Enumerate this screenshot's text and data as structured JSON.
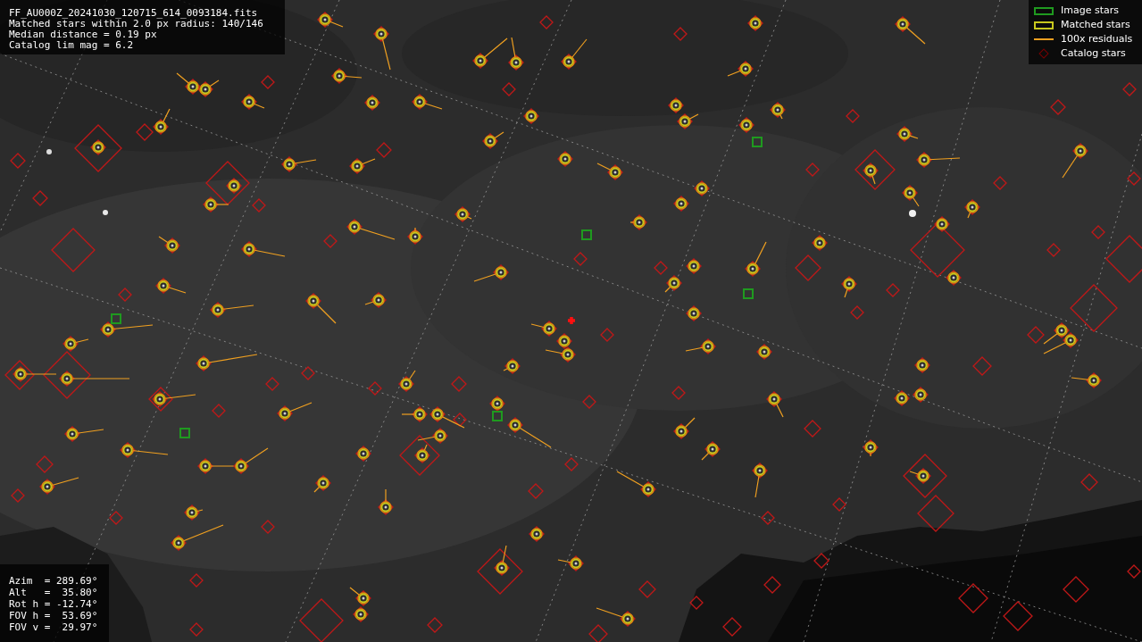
{
  "info_box": {
    "lines": [
      "FF_AU000Z_20241030_120715_614_0093184.fits",
      "Matched stars within 2.0 px radius: 140/146",
      "Median distance = 0.19 px",
      "Catalog lim mag = 6.2"
    ]
  },
  "legend": [
    {
      "label": "Image stars",
      "kind": "box",
      "color": "#1f9a1f"
    },
    {
      "label": "Matched stars",
      "kind": "box",
      "color": "#c8c81e"
    },
    {
      "label": "100x residuals",
      "kind": "line",
      "color": "#f0a020"
    },
    {
      "label": "Catalog stars",
      "kind": "diamond",
      "color": "#7a0000"
    }
  ],
  "pointing": {
    "lines": [
      "Azim  = 289.69°",
      "Alt   =  35.80°",
      "Rot h = -12.74°",
      "FOV h =  53.69°",
      "FOV v =  29.97°"
    ]
  }
}
